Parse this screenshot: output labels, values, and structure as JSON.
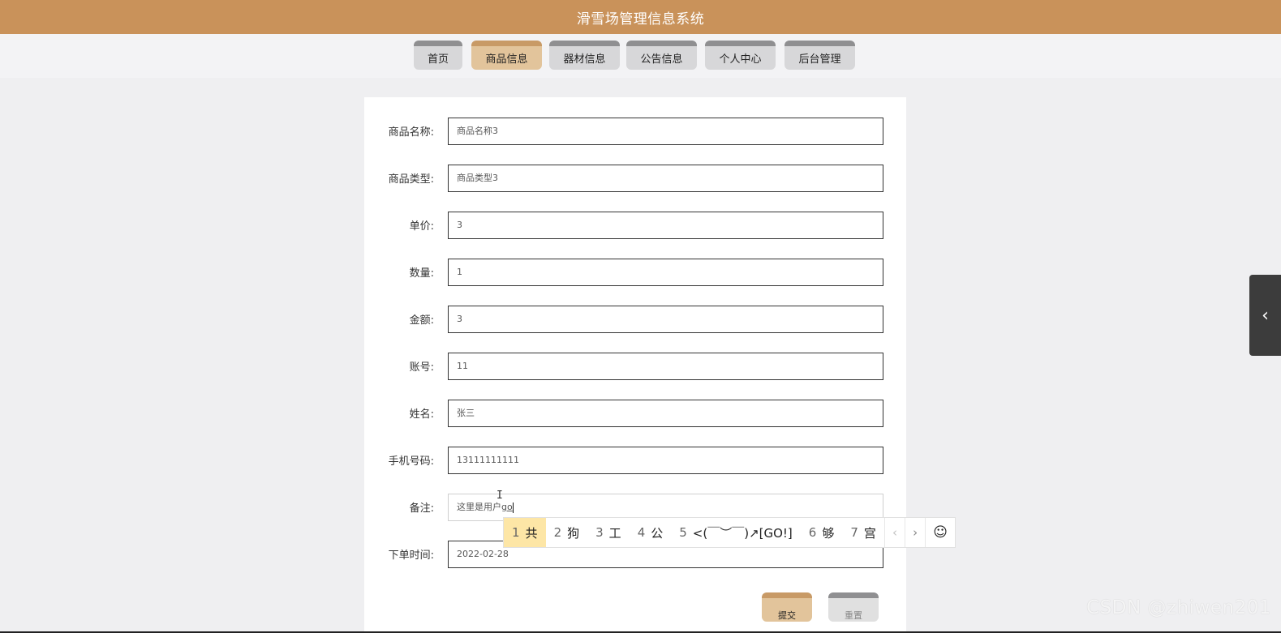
{
  "header": {
    "title": "滑雪场管理信息系统"
  },
  "nav": {
    "items": [
      {
        "label": "首页"
      },
      {
        "label": "商品信息",
        "active": true
      },
      {
        "label": "器材信息"
      },
      {
        "label": "公告信息"
      },
      {
        "label": "个人中心"
      },
      {
        "label": "后台管理"
      }
    ]
  },
  "form": {
    "fields": [
      {
        "label": "商品名称:",
        "value": "商品名称3"
      },
      {
        "label": "商品类型:",
        "value": "商品类型3"
      },
      {
        "label": "单价:",
        "value": "3"
      },
      {
        "label": "数量:",
        "value": "1"
      },
      {
        "label": "金额:",
        "value": "3"
      },
      {
        "label": "账号:",
        "value": "11"
      },
      {
        "label": "姓名:",
        "value": "张三"
      },
      {
        "label": "手机号码:",
        "value": "13111111111"
      },
      {
        "label": "备注:",
        "value": "这里是用户",
        "composing": "go"
      },
      {
        "label": "下单时间:",
        "value": "2022-02-28"
      }
    ],
    "submit_label": "提交",
    "reset_label": "重置"
  },
  "ime": {
    "candidates": [
      {
        "num": "1",
        "text": "共",
        "selected": true
      },
      {
        "num": "2",
        "text": "狗"
      },
      {
        "num": "3",
        "text": "工"
      },
      {
        "num": "4",
        "text": "公"
      },
      {
        "num": "5",
        "text": "<(￣︶￣)↗[GO!]"
      },
      {
        "num": "6",
        "text": "够"
      },
      {
        "num": "7",
        "text": "宫"
      }
    ],
    "prev_icon": "‹",
    "next_icon": "›",
    "emoji_icon": "☺"
  },
  "side_panel": {
    "icon": "‹"
  },
  "watermark": "CSDN @zhiwen201"
}
